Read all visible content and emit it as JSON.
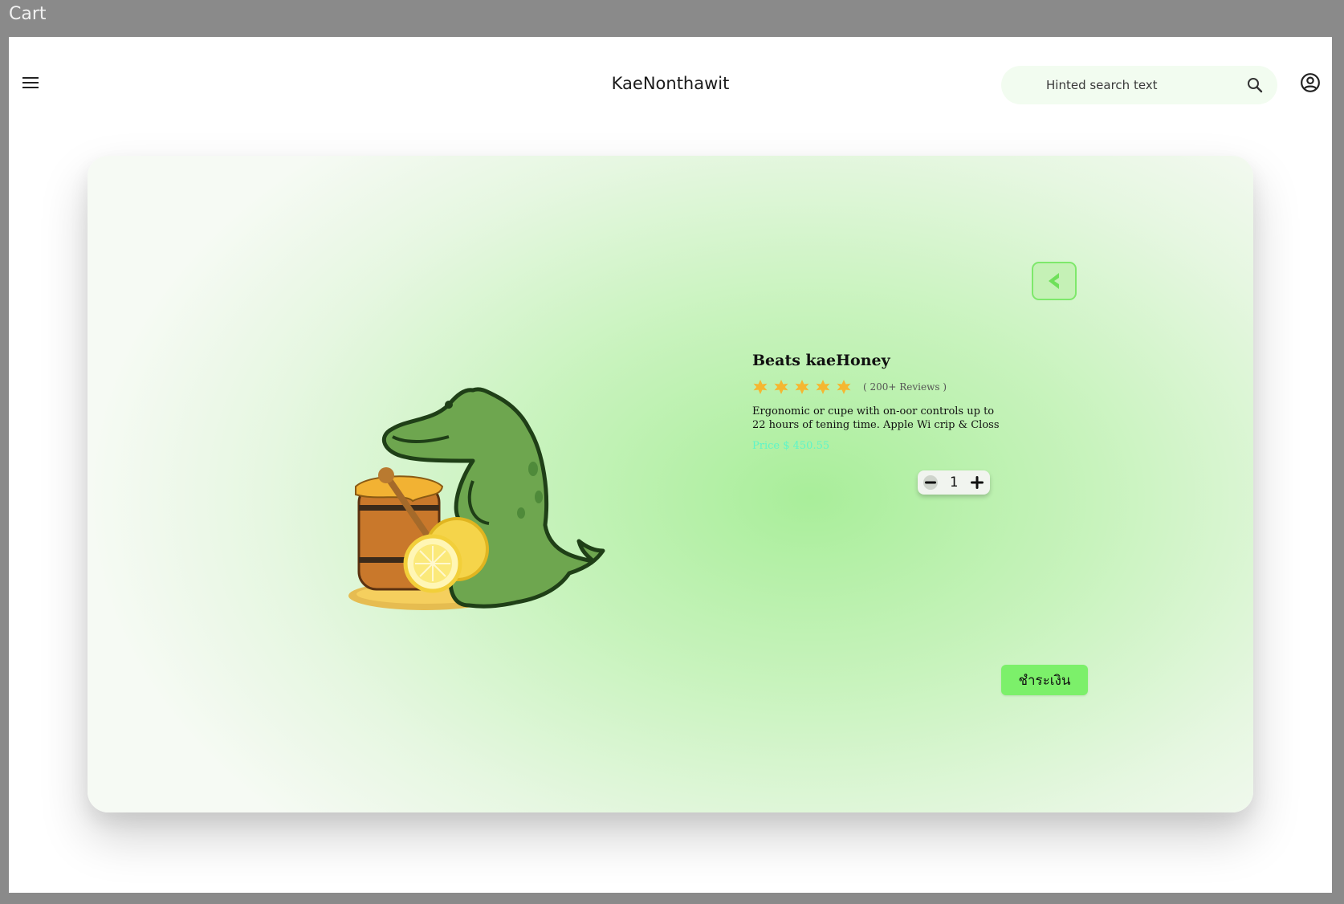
{
  "window": {
    "title": "Cart"
  },
  "header": {
    "menu_icon": "menu-icon",
    "brand": "KaeNonthawit",
    "search_placeholder": "Hinted search text",
    "search_icon": "search-icon",
    "account_icon": "account-circle-icon"
  },
  "product": {
    "name": "Beats kaeHoney",
    "rating": 5,
    "rating_max": 5,
    "reviews": "( 200+ Reviews )",
    "description": "Ergonomic or cupe with on-oor controls up to 22 hours of tening time. Apple Wi crip & Closs",
    "price": "Price $ 450.55",
    "image": "crocodile-with-honey-barrel-and-lemon",
    "quantity": "1"
  },
  "actions": {
    "back_icon": "chevron-left-icon",
    "decrement_icon": "minus-icon",
    "increment_icon": "plus-icon",
    "pay_label": "ชำระเงิน"
  },
  "colors": {
    "accent": "#7cf06a",
    "price": "#5ef5c8",
    "star": "#f5b731",
    "card_center": "#a9ee9a"
  }
}
